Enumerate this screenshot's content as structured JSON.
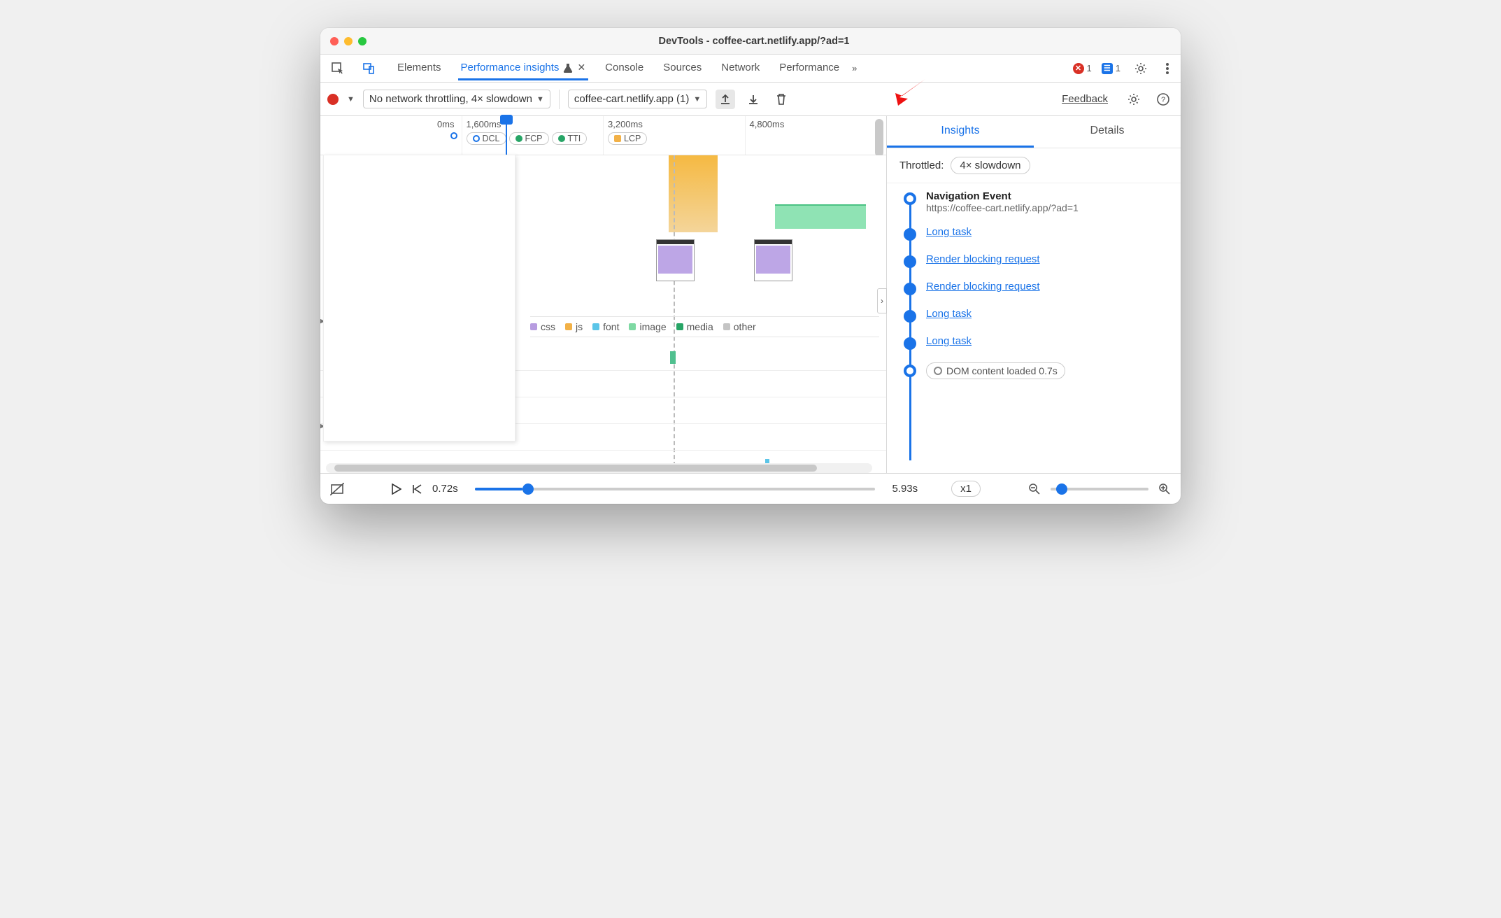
{
  "window": {
    "title": "DevTools - coffee-cart.netlify.app/?ad=1"
  },
  "tabs": {
    "elements": "Elements",
    "perf_insights": "Performance insights",
    "console": "Console",
    "sources": "Sources",
    "network": "Network",
    "performance": "Performance",
    "errors_count": "1",
    "messages_count": "1"
  },
  "toolbar": {
    "throttle_select": "No network throttling, 4× slowdown",
    "recording_select": "coffee-cart.netlify.app (1)",
    "feedback": "Feedback"
  },
  "ruler": {
    "ticks": [
      "0ms",
      "1,600ms",
      "3,200ms",
      "4,800ms"
    ],
    "markers": {
      "dcl": "DCL",
      "fcp": "FCP",
      "tti": "TTI",
      "lcp": "LCP"
    }
  },
  "legend": {
    "css": "css",
    "js": "js",
    "font": "font",
    "image": "image",
    "media": "media",
    "other": "other"
  },
  "right": {
    "tab_insights": "Insights",
    "tab_details": "Details",
    "throttled_label": "Throttled:",
    "throttled_value": "4× slowdown",
    "nav_title": "Navigation Event",
    "nav_url": "https://coffee-cart.netlify.app/?ad=1",
    "items": [
      "Long task",
      "Render blocking request",
      "Render blocking request",
      "Long task",
      "Long task"
    ],
    "dom_chip": "DOM content loaded 0.7s"
  },
  "footer": {
    "current_time": "0.72s",
    "total_time": "5.93s",
    "zoom_level": "x1"
  },
  "colors": {
    "css": "#b79ce0",
    "js": "#f2b147",
    "font": "#5bc5e8",
    "image": "#7ed9a3",
    "media": "#27a566",
    "other": "#c4c4c4"
  }
}
